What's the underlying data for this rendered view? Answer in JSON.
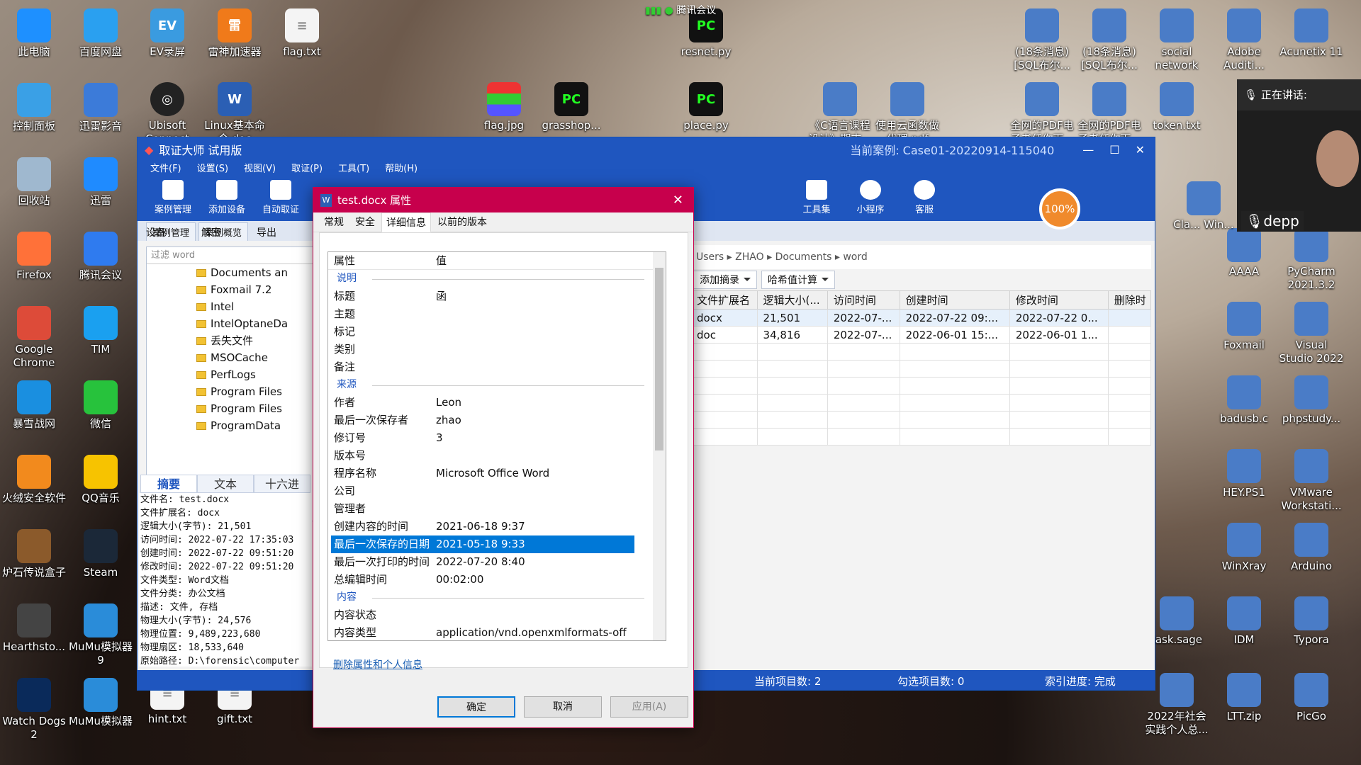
{
  "desktop": {
    "left_icons": [
      "此电脑",
      "控制面板",
      "回收站",
      "Firefox",
      "Google Chrome",
      "暴雪战网",
      "火绒安全软件",
      "炉石传说盒子",
      "Hearthsto...",
      "Watch Dogs 2"
    ],
    "col2_icons": [
      "百度网盘",
      "迅雷影音",
      "迅雷",
      "腾讯会议",
      "TIM",
      "微信",
      "QQ音乐",
      "Steam",
      "MuMu模拟器9",
      "MuMu模拟器"
    ],
    "top_icons": [
      "EV录屏",
      "雷神加速器",
      "flag.txt",
      "Ubisoft Connect",
      "Linux基本命令.doc",
      "flag.jpg",
      "grasshop...",
      "place.py",
      "resnet.py",
      "hint.txt",
      "gift.txt"
    ],
    "right_icons": [
      "(18条消息)[SQL布尔...",
      "(18条消息)[SQL布尔...",
      "social network",
      "Adobe Auditi...",
      "Acunetix 11",
      "《C语言课程设计》期末...",
      "使用云函数做代理.pdf",
      "全网的PDF电子书任你下...",
      "全网的PDF电子书任你下...",
      "token.txt",
      "AAAA",
      "PyCharm 2021.3.2",
      "Foxmail",
      "Visual Studio 2022",
      "badusb.c",
      "phpstudy...",
      "HEY.PS1",
      "VMware Workstati...",
      "WinXray",
      "Arduino",
      "IDM",
      "Typora",
      "task.sage",
      "2022年社会实践个人总...",
      "LTT.zip",
      "PicGo",
      "Cla... Win..."
    ],
    "meeting": {
      "top": "腾讯会议",
      "speaking": "正在讲话:",
      "user": "depp"
    }
  },
  "app": {
    "title": "取证大师 试用版",
    "case": "当前案例:  Case01-20220914-115040",
    "menu": [
      "文件(F)",
      "设置(S)",
      "视图(V)",
      "取证(P)",
      "工具(T)",
      "帮助(H)"
    ],
    "toolbar": [
      "案例管理",
      "添加设备",
      "自动取证",
      "工具集",
      "小程序",
      "客服"
    ],
    "progress": "100%",
    "tabs": [
      "案例管理",
      "案例概览"
    ],
    "left_buttons": [
      "设备",
      "解密",
      "导出"
    ],
    "filter_placeholder": "过滤 word",
    "tree": [
      "Documents an",
      "Foxmail 7.2",
      "Intel",
      "IntelOptaneDa",
      "丢失文件",
      "MSOCache",
      "PerfLogs",
      "Program Files",
      "Program Files",
      "ProgramData"
    ],
    "sum_tabs": [
      "摘要",
      "文本",
      "十六进"
    ],
    "summary": [
      "文件名: test.docx",
      "文件扩展名: docx",
      "逻辑大小(字节): 21,501",
      "访问时间: 2022-07-22 17:35:03",
      "创建时间: 2022-07-22 09:51:20",
      "修改时间: 2022-07-22 09:51:20",
      "文件类型: Word文档",
      "文件分类: 办公文档",
      "描述: 文件, 存档",
      "物理大小(字节): 24,576",
      "物理位置: 9,489,223,680",
      "物理扇区: 18,533,640",
      "原始路径: D:\\forensic\\computer"
    ],
    "crumb": [
      "Users",
      "ZHAO",
      "Documents",
      "word"
    ],
    "right_buttons": [
      "添加摘录",
      "哈希值计算"
    ],
    "cols": [
      "文件扩展名",
      "逻辑大小(...",
      "访问时间",
      "创建时间",
      "修改时间",
      "删除时"
    ],
    "rows": [
      [
        "docx",
        "21,501",
        "2022-07-...",
        "2022-07-22 09:...",
        "2022-07-22 0..."
      ],
      [
        "doc",
        "34,816",
        "2022-07-...",
        "2022-06-01 15:...",
        "2022-06-01 1..."
      ]
    ],
    "status": {
      "count": "当前项目数: 2",
      "checked": "勾选项目数: 0",
      "index": "索引进度: 完成"
    }
  },
  "dialog": {
    "title": "test.docx 属性",
    "tabs": [
      "常规",
      "安全",
      "详细信息",
      "以前的版本"
    ],
    "header": [
      "属性",
      "值"
    ],
    "sections": [
      {
        "name": "说明",
        "rows": [
          [
            "标题",
            "函"
          ],
          [
            "主题",
            ""
          ],
          [
            "标记",
            ""
          ],
          [
            "类别",
            ""
          ],
          [
            "备注",
            ""
          ]
        ]
      },
      {
        "name": "来源",
        "rows": [
          [
            "作者",
            "Leon"
          ],
          [
            "最后一次保存者",
            "zhao"
          ],
          [
            "修订号",
            "3"
          ],
          [
            "版本号",
            ""
          ],
          [
            "程序名称",
            "Microsoft Office Word"
          ],
          [
            "公司",
            ""
          ],
          [
            "管理者",
            ""
          ],
          [
            "创建内容的时间",
            "2021-06-18 9:37"
          ],
          [
            "最后一次保存的日期",
            "2021-05-18 9:33"
          ],
          [
            "最后一次打印的时间",
            "2022-07-20 8:40"
          ],
          [
            "总编辑时间",
            "00:02:00"
          ]
        ]
      },
      {
        "name": "内容",
        "rows": [
          [
            "内容状态",
            ""
          ],
          [
            "内容类型",
            "application/vnd.openxmlformats-off"
          ]
        ]
      }
    ],
    "link": "删除属性和个人信息",
    "ok": "确定",
    "cancel": "取消",
    "apply": "应用(A)"
  }
}
